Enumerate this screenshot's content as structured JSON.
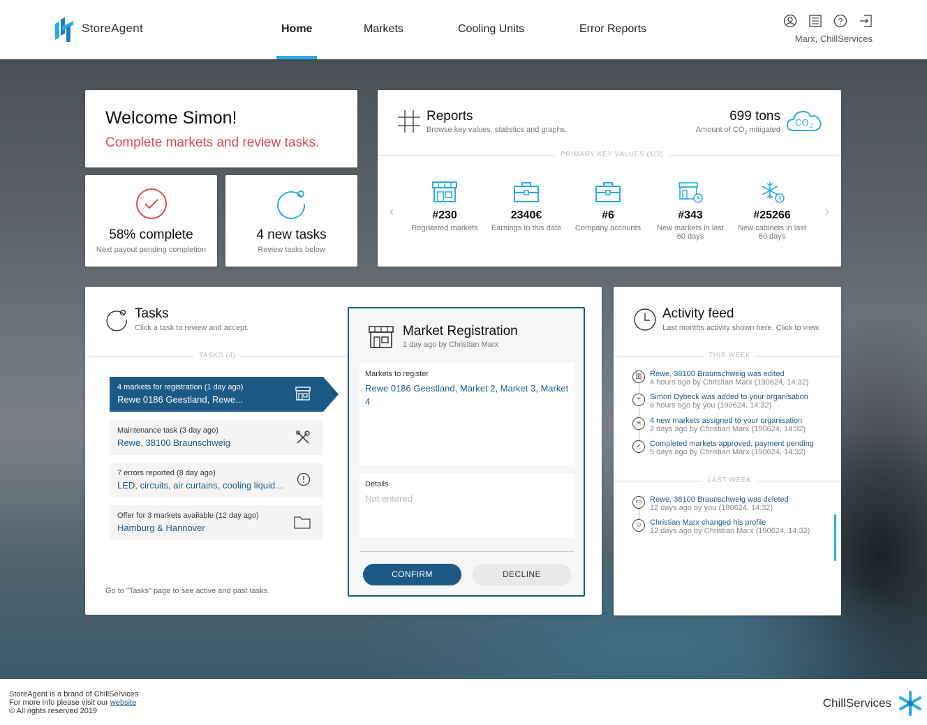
{
  "brand": {
    "name": "StoreAgent"
  },
  "nav": {
    "items": [
      {
        "label": "Home",
        "active": true
      },
      {
        "label": "Markets"
      },
      {
        "label": "Cooling Units"
      },
      {
        "label": "Error Reports"
      }
    ]
  },
  "header": {
    "user": "Marx, ChillServices",
    "icons": [
      "user-icon",
      "list-icon",
      "help-icon",
      "logout-icon"
    ]
  },
  "welcome": {
    "title": "Welcome Simon!",
    "subtitle": "Complete markets and review tasks."
  },
  "stats": {
    "progress": {
      "title": "58% complete",
      "sub": "Next payout pending completion",
      "icon": "check-circle-icon"
    },
    "tasks": {
      "title": "4 new tasks",
      "sub": "Review tasks below",
      "icon": "task-circle-icon"
    }
  },
  "reports": {
    "title": "Reports",
    "subtitle": "Browse key values, statistics and graphs.",
    "co2_value": "699 tons",
    "co2_label_prefix": "Amount of CO",
    "co2_label_sub": "2",
    "co2_label_suffix": " mitigated",
    "co2_badge": "CO",
    "co2_badge_sub": "2",
    "section_label": "PRIMARY KEY VALUES (1/3)",
    "kpis": [
      {
        "value": "#230",
        "label": "Registered markets",
        "icon": "store-icon"
      },
      {
        "value": "2340€",
        "label": "Earnings to this date",
        "icon": "briefcase-icon"
      },
      {
        "value": "#6",
        "label": "Company accounts",
        "icon": "briefcase-icon"
      },
      {
        "value": "#343",
        "label": "New markets in last 60 days",
        "icon": "store-clock-icon"
      },
      {
        "value": "#25266",
        "label": "New cabinets in last 60 days",
        "icon": "snowflake-clock-icon"
      }
    ]
  },
  "tasks": {
    "title": "Tasks",
    "subtitle": "Click a task to review and accept.",
    "section_label": "TASKS (4)",
    "items": [
      {
        "top": "4 markets for registration (1 day ago)",
        "main": "Rewe 0186 Geestland, Rewe...",
        "icon": "store-icon",
        "active": true
      },
      {
        "top": "Maintenance task (3 day ago)",
        "main": "Rewe, 38100 Braunschweig",
        "icon": "tools-icon"
      },
      {
        "top": "7 errors reported (8 day ago)",
        "main": "LED, circuits, air curtains, cooling liquid...",
        "icon": "alert-icon"
      },
      {
        "top": "Offer for 3 markets available (12 day ago)",
        "main": "Hamburg & Hannover",
        "icon": "folder-icon"
      }
    ],
    "footer": "Go to \"Tasks\" page to see active and past tasks."
  },
  "market_registration": {
    "title": "Market Registration",
    "subtitle": "1 day ago by Christian Marx",
    "markets_label": "Markets to register",
    "markets_value": "Rewe 0186 Geestland, Market 2, Market 3, Market 4",
    "details_label": "Details",
    "details_placeholder": "Not entered",
    "confirm_label": "CONFIRM",
    "decline_label": "DECLINE"
  },
  "activity": {
    "title": "Activity feed",
    "subtitle": "Last months activity shown here. Click to view.",
    "this_week_label": "THIS WEEK",
    "last_week_label": "LAST WEEK",
    "this_week": [
      {
        "main": "Rewe, 38100 Braunschweig was edited",
        "sub": "4 hours ago by Christian Marx (190624, 14:32)",
        "icon": "store-icon"
      },
      {
        "main": "Simon Dybeck was added to your organisation",
        "sub": "6 hours ago by you (190624, 14:32)",
        "icon": "plus-icon"
      },
      {
        "main": "4 new markets assigned to your organisation",
        "sub": "2 days ago by Christian Marx (190624, 14:32)",
        "icon": "list-icon"
      },
      {
        "main": "Completed markets approved, payment pending",
        "sub": "5 days ago by Christian Marx (190624, 14:32)",
        "icon": "check-icon"
      }
    ],
    "last_week": [
      {
        "main": "Rewe, 38100 Braunschweig was deleted",
        "sub": "12 days ago by you (190624, 14:32)",
        "icon": "trash-icon"
      },
      {
        "main": "Christian Marx changed his profile",
        "sub": "12 days ago by Christian Marx (190624, 14:32)",
        "icon": "user-icon"
      }
    ]
  },
  "footer": {
    "line1": "StoreAgent is a brand of ChillServices",
    "line2_prefix": "For more info please visit our ",
    "line2_link": "website",
    "line3": "© All rights reserved 2019",
    "brand": "ChillServices"
  },
  "colors": {
    "primary": "#1c5a85",
    "accent": "#29abe2",
    "alert": "#e0484d"
  }
}
